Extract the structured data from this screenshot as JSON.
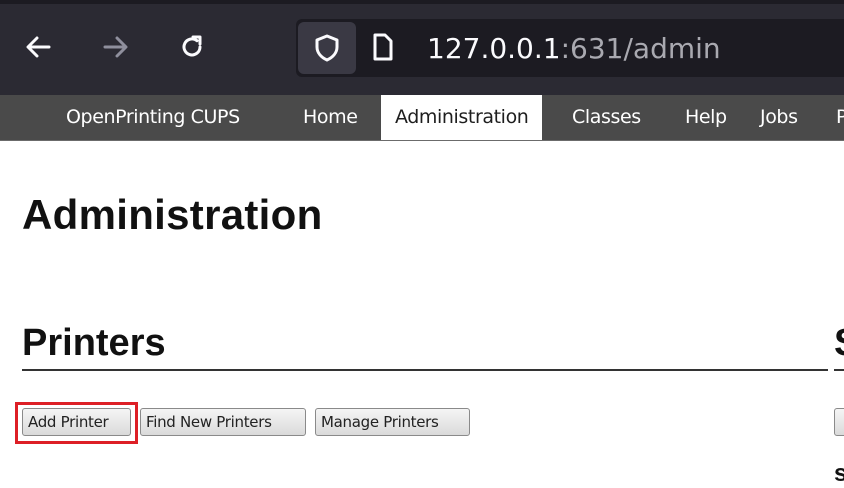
{
  "browser": {
    "url_host": "127.0.0.1",
    "url_path": ":631/admin"
  },
  "nav": {
    "items": [
      {
        "label": "OpenPrinting CUPS",
        "active": false
      },
      {
        "label": "Home",
        "active": false
      },
      {
        "label": "Administration",
        "active": true
      },
      {
        "label": "Classes",
        "active": false
      },
      {
        "label": "Help",
        "active": false
      },
      {
        "label": "Jobs",
        "active": false
      },
      {
        "label": "P",
        "active": false
      }
    ]
  },
  "page": {
    "title": "Administration"
  },
  "printers": {
    "heading": "Printers",
    "buttons": {
      "add": "Add Printer",
      "find": "Find New Printers",
      "manage": "Manage Printers"
    }
  },
  "right_column": {
    "heading": "S",
    "subtext": "s"
  },
  "colors": {
    "browser_bg": "#2b2a33",
    "nav_bg": "#4a4a4a",
    "highlight": "#dd1f26"
  }
}
